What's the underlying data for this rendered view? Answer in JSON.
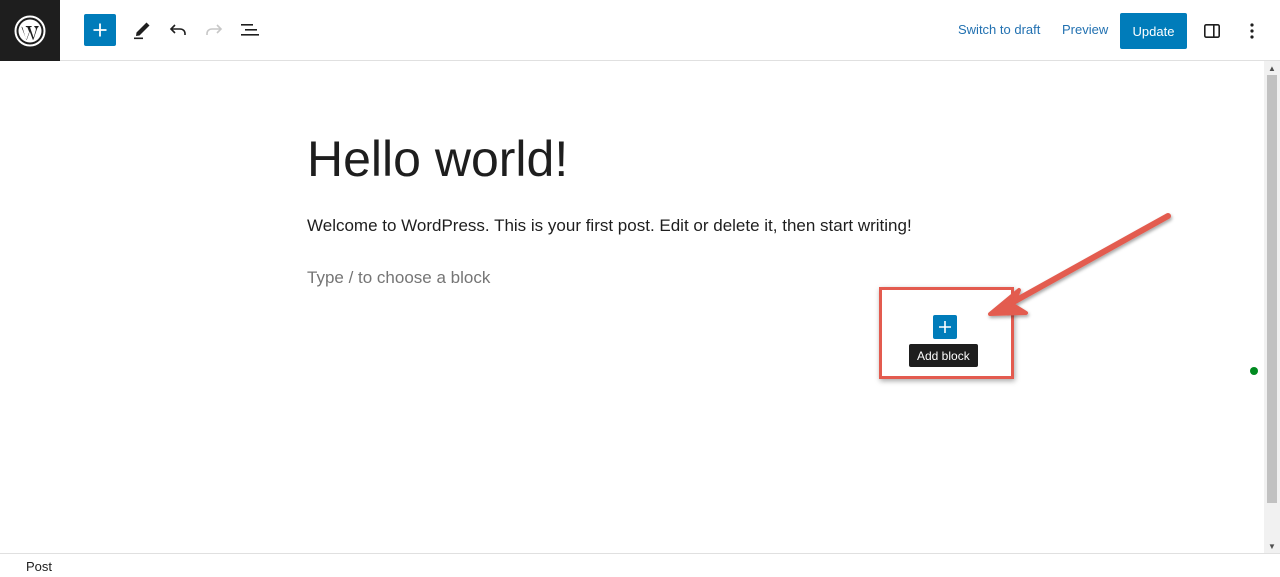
{
  "toolbar": {
    "logo_icon": "wordpress-logo-icon",
    "add_icon": "plus-icon",
    "tools_icon": "pencil-icon",
    "undo_icon": "undo-icon",
    "redo_icon": "redo-icon",
    "outline_icon": "document-overview-icon",
    "switch_to_draft_label": "Switch to draft",
    "preview_label": "Preview",
    "update_label": "Update",
    "settings_icon": "sidebar-toggle-icon",
    "options_icon": "more-vertical-icon",
    "accent_color": "#007cba"
  },
  "post": {
    "title": "Hello world!",
    "paragraph": "Welcome to WordPress. This is your first post. Edit or delete it, then start writing!",
    "block_placeholder": "Type / to choose a block"
  },
  "inserter": {
    "icon": "plus-icon",
    "tooltip": "Add block",
    "highlight_color": "#e35b4f"
  },
  "footer": {
    "breadcrumb": "Post"
  }
}
